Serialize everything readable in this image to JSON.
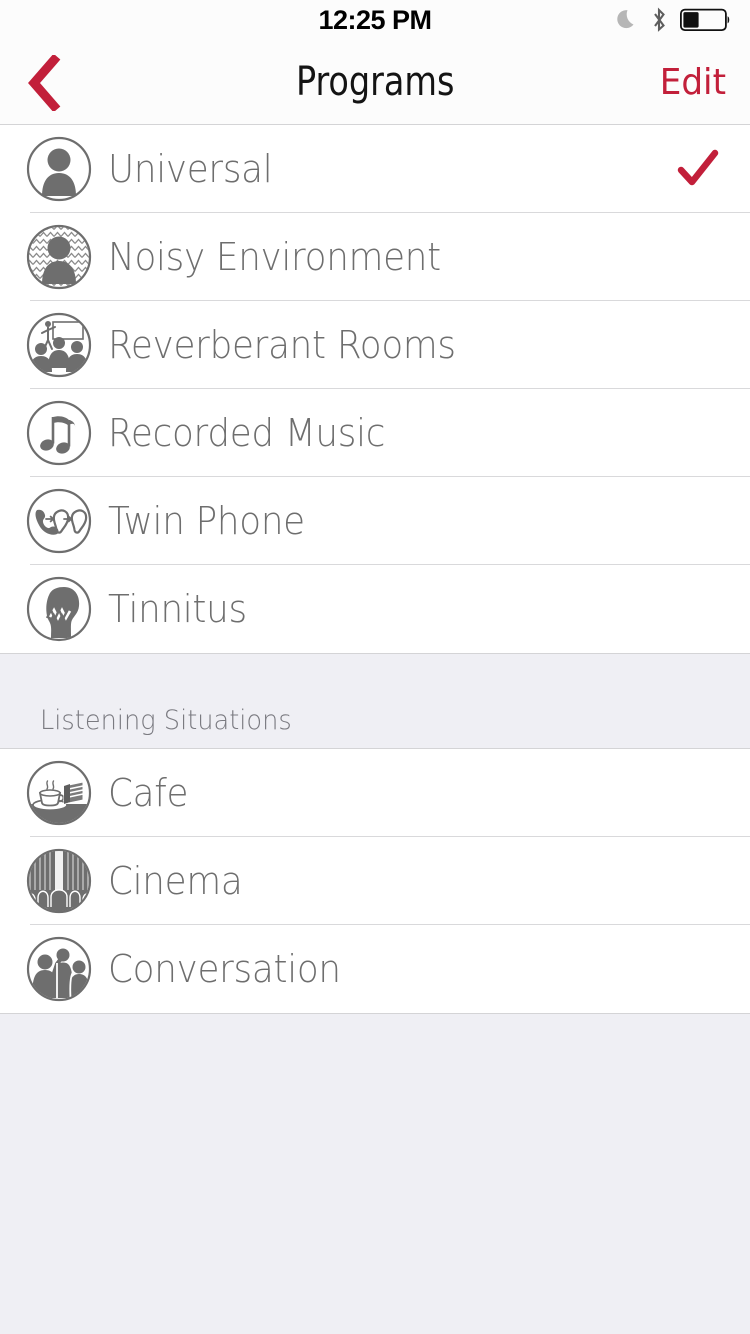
{
  "status_bar": {
    "time": "12:25 PM",
    "icons": [
      "do-not-disturb-moon-icon",
      "bluetooth-icon",
      "battery-icon"
    ],
    "battery_level_percent": 35
  },
  "nav_bar": {
    "back_icon": "chevron-left-icon",
    "title": "Programs",
    "edit_label": "Edit",
    "accent_color": "#C21F3A"
  },
  "colors": {
    "accent": "#C21F3A",
    "list_background": "#FFFFFF",
    "page_background": "#EFEFF4",
    "label_text": "#6E6E6E",
    "separator": "#D9D9DB",
    "icon_gray": "#6E6E6E"
  },
  "sections": [
    {
      "header": null,
      "rows": [
        {
          "label": "Universal",
          "icon": "person-silhouette-icon",
          "selected": true
        },
        {
          "label": "Noisy Environment",
          "icon": "person-noise-pattern-icon",
          "selected": false
        },
        {
          "label": "Reverberant Rooms",
          "icon": "lecture-audience-icon",
          "selected": false
        },
        {
          "label": "Recorded Music",
          "icon": "music-notes-icon",
          "selected": false
        },
        {
          "label": "Twin Phone",
          "icon": "phone-two-ears-icon",
          "selected": false
        },
        {
          "label": "Tinnitus",
          "icon": "head-profile-zigzag-icon",
          "selected": false
        }
      ]
    },
    {
      "header": "Listening Situations",
      "rows": [
        {
          "label": "Cafe",
          "icon": "coffee-cake-icon",
          "selected": false
        },
        {
          "label": "Cinema",
          "icon": "cinema-screen-seats-icon",
          "selected": false
        },
        {
          "label": "Conversation",
          "icon": "people-talking-icon",
          "selected": false
        }
      ]
    }
  ]
}
